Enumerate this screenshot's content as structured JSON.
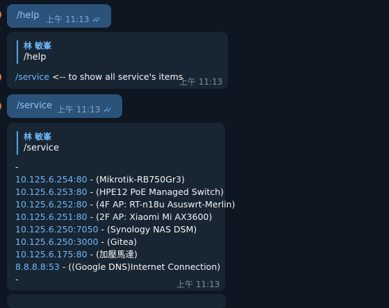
{
  "messages": [
    {
      "text": "/help",
      "time": "上午 11:13"
    },
    {
      "reply_name": "林 敏峯",
      "reply_text": "/help",
      "cmd": "/service",
      "rest": "<-- to show all service's items",
      "time": "上午 11:13"
    },
    {
      "text": "/service",
      "time": "上午 11:13"
    },
    {
      "reply_name": "林 敏峯",
      "reply_text": "/service",
      "dash_top": "-",
      "services": [
        {
          "addr": "10.125.6.254:80",
          "desc": " - (Mikrotik-RB750Gr3)"
        },
        {
          "addr": "10.125.6.253:80",
          "desc": " - (HPE12 PoE Managed Switch)"
        },
        {
          "addr": "10.125.6.252:80",
          "desc": " - (4F AP: RT-n18u Asuswrt-Merlin)"
        },
        {
          "addr": "10.125.6.251:80",
          "desc": " - (2F AP: Xiaomi Mi AX3600)"
        },
        {
          "addr": "10.125.6.250:7050",
          "desc": " - (Synology NAS DSM)"
        },
        {
          "addr": "10.125.6.250:3000",
          "desc": " - (Gitea)"
        },
        {
          "addr": "10.125.6.175:80",
          "desc": " - (加壓馬達)"
        },
        {
          "addr": "8.8.8.8:53",
          "desc": " - ((Google DNS)Internet Connection)"
        }
      ],
      "dash_bottom": "-",
      "time": "上午 11:13"
    }
  ],
  "icons": {
    "read": "double-check-icon",
    "avatar": "avatar-icon"
  },
  "colors": {
    "background": "#0e1621",
    "outgoing": "#2b5278",
    "incoming": "#182533",
    "link": "#71b7f5"
  }
}
